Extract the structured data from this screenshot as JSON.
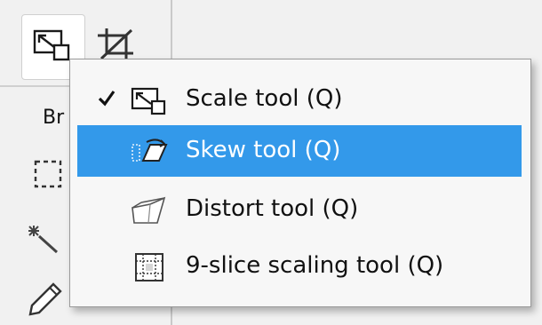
{
  "toolbar": {
    "active_tool_icon": "scale-tool-icon",
    "crop_tool_icon": "crop-icon",
    "brush_label": "Br"
  },
  "menu": {
    "items": [
      {
        "label": "Scale tool (Q)",
        "icon": "scale-tool-icon",
        "checked": true,
        "highlighted": false
      },
      {
        "label": "Skew tool (Q)",
        "icon": "skew-tool-icon",
        "checked": false,
        "highlighted": true
      },
      {
        "label": "Distort tool (Q)",
        "icon": "distort-tool-icon",
        "checked": false,
        "highlighted": false
      },
      {
        "label": "9-slice scaling tool (Q)",
        "icon": "nine-slice-tool-icon",
        "checked": false,
        "highlighted": false
      }
    ]
  },
  "colors": {
    "highlight": "#3399ea",
    "menu_bg": "#f7f7f7",
    "panel_bg": "#f1f1f1"
  }
}
